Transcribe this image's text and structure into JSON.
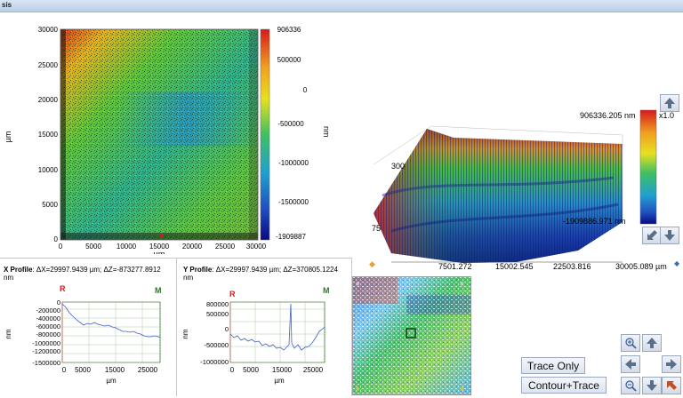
{
  "window": {
    "title_fragment": "sis"
  },
  "heatmap": {
    "yticks": [
      "30000",
      "25000",
      "20000",
      "15000",
      "10000",
      "5000",
      "0"
    ],
    "xticks": [
      "0",
      "5000",
      "10000",
      "15000",
      "20000",
      "25000",
      "30000"
    ],
    "ylabel": "µm",
    "xlabel": "µm",
    "colorbar_ticks": [
      "906336",
      "500000",
      "0",
      "-500000",
      "-1000000",
      "-1500000",
      "-1909887"
    ],
    "colorbar_unit": "nm"
  },
  "view3d": {
    "max_label": "906336.205 nm",
    "min_label": "-1909886.971 nm",
    "zoom": "x1.0",
    "axis_ticks": [
      "7501.272",
      "15002.545",
      "22503.816",
      "30005.089 µm"
    ],
    "edge_label_top": "300",
    "edge_label_left": "75"
  },
  "xprofile": {
    "title": "X Profile",
    "info": ": ΔX=29997.9439 µm; ΔZ=-873277.8912",
    "unit_line": "nm",
    "marker_r": "R",
    "marker_m": "M",
    "yticks": [
      "0",
      "-200000",
      "-400000",
      "-600000",
      "-800000",
      "-1000000",
      "-1200000",
      "-1500000"
    ],
    "xticks": [
      "0",
      "5000",
      "15000",
      "25000"
    ],
    "ylabel": "nm",
    "xlabel": "µm"
  },
  "yprofile": {
    "title": "Y Profile",
    "info": ": ΔX=29997.9439 µm; ΔZ=370805.1224",
    "unit_line": "nm",
    "marker_r": "R",
    "marker_m": "M",
    "yticks": [
      "800000",
      "500000",
      "0",
      "-500000",
      "-1000000"
    ],
    "xticks": [
      "0",
      "5000",
      "15000",
      "25000"
    ],
    "ylabel": "nm",
    "xlabel": "µm"
  },
  "buttons": {
    "trace_only": "Trace Only",
    "contour_trace": "Contour+Trace"
  },
  "icons": {
    "rotate_up": "arrow-up-icon",
    "rotate_down": "arrow-down-icon",
    "rotate_left": "arrow-left-icon",
    "rotate_right": "arrow-right-icon",
    "zoom_in": "zoom-in-icon",
    "zoom_out": "zoom-out-icon"
  },
  "colors": {
    "high": "#d7191c",
    "mid": "#33cc66",
    "low": "#0a1a9a",
    "accent": "#3a6ea5"
  }
}
